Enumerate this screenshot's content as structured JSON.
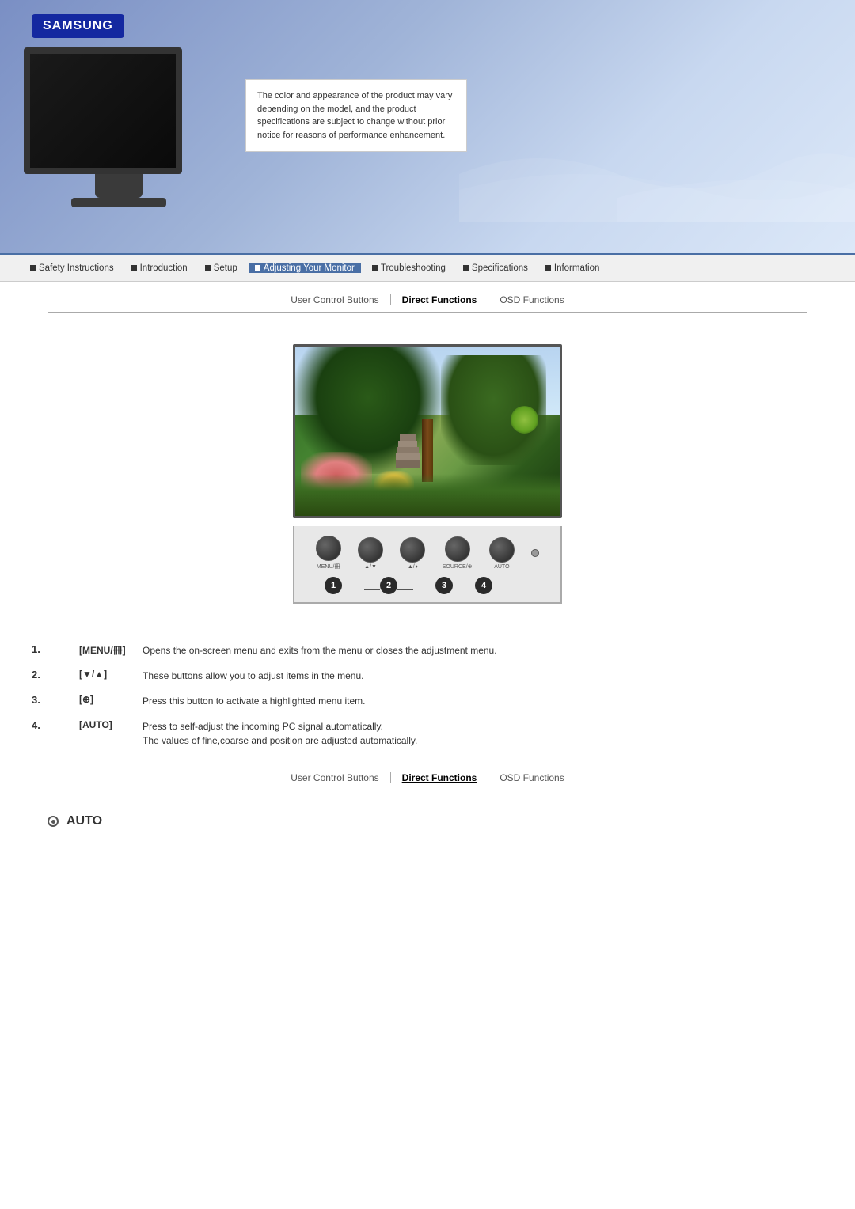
{
  "brand": {
    "name": "SAMSUNG"
  },
  "banner": {
    "disclaimer": "The color and appearance of the product may vary depending on the model, and the product specifications are subject to change without prior notice for reasons of performance enhancement."
  },
  "nav": {
    "items": [
      {
        "id": "safety",
        "label": "Safety Instructions",
        "active": false
      },
      {
        "id": "intro",
        "label": "Introduction",
        "active": false
      },
      {
        "id": "setup",
        "label": "Setup",
        "active": false
      },
      {
        "id": "adjusting",
        "label": "Adjusting Your Monitor",
        "active": true
      },
      {
        "id": "troubleshooting",
        "label": "Troubleshooting",
        "active": false
      },
      {
        "id": "specifications",
        "label": "Specifications",
        "active": false
      },
      {
        "id": "information",
        "label": "Information",
        "active": false
      }
    ]
  },
  "tabs": {
    "top": [
      {
        "id": "user-control",
        "label": "User Control Buttons",
        "active": false
      },
      {
        "id": "direct-functions",
        "label": "Direct Functions",
        "active": true
      },
      {
        "id": "osd-functions",
        "label": "OSD Functions",
        "active": false
      }
    ],
    "bottom": [
      {
        "id": "user-control",
        "label": "User Control Buttons",
        "active": false
      },
      {
        "id": "direct-functions",
        "label": "Direct Functions",
        "active": true
      },
      {
        "id": "osd-functions",
        "label": "OSD Functions",
        "active": false
      }
    ]
  },
  "button_panel": {
    "buttons": [
      {
        "label": "MENU/冊"
      },
      {
        "label": "▲/▼"
      },
      {
        "label": "▲/◑"
      },
      {
        "label": "SOURCE/⊕"
      },
      {
        "label": "AUTO"
      }
    ],
    "callouts": [
      "1",
      "2",
      "3",
      "4"
    ]
  },
  "instructions": [
    {
      "number": "1.",
      "key": "[MENU/冊]",
      "description": "Opens the on-screen menu and exits from the menu or closes the adjustment menu."
    },
    {
      "number": "2.",
      "key": "[▼/▲]",
      "description": "These buttons allow you to adjust items in the menu."
    },
    {
      "number": "3.",
      "key": "[⊕]",
      "description": "Press this button to activate a highlighted menu item."
    },
    {
      "number": "4.",
      "key": "[AUTO]",
      "description": "Press to self-adjust the incoming PC signal automatically.\nThe values of fine,coarse and position are adjusted automatically."
    }
  ],
  "auto_section": {
    "label": "AUTO"
  }
}
